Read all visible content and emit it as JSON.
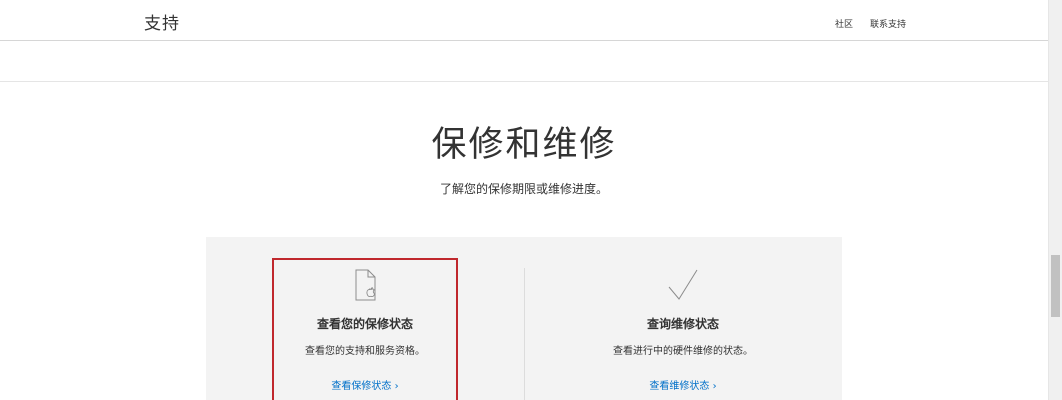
{
  "header": {
    "brand": "支持",
    "nav": [
      "社区",
      "联系支持"
    ]
  },
  "hero": {
    "title": "保修和维修",
    "subtitle": "了解您的保修期限或维修进度。"
  },
  "cards": [
    {
      "icon": "document-apple-icon",
      "title": "查看您的保修状态",
      "description": "查看您的支持和服务资格。",
      "link": "查看保修状态",
      "link_chevron": "›"
    },
    {
      "icon": "checkmark-icon",
      "title": "查询维修状态",
      "description": "查看进行中的硬件维修的状态。",
      "link": "查看维修状态",
      "link_chevron": "›"
    }
  ],
  "colors": {
    "accent_link": "#0070c9",
    "highlight_border": "#c0282d",
    "panel_bg": "#f3f3f3"
  }
}
